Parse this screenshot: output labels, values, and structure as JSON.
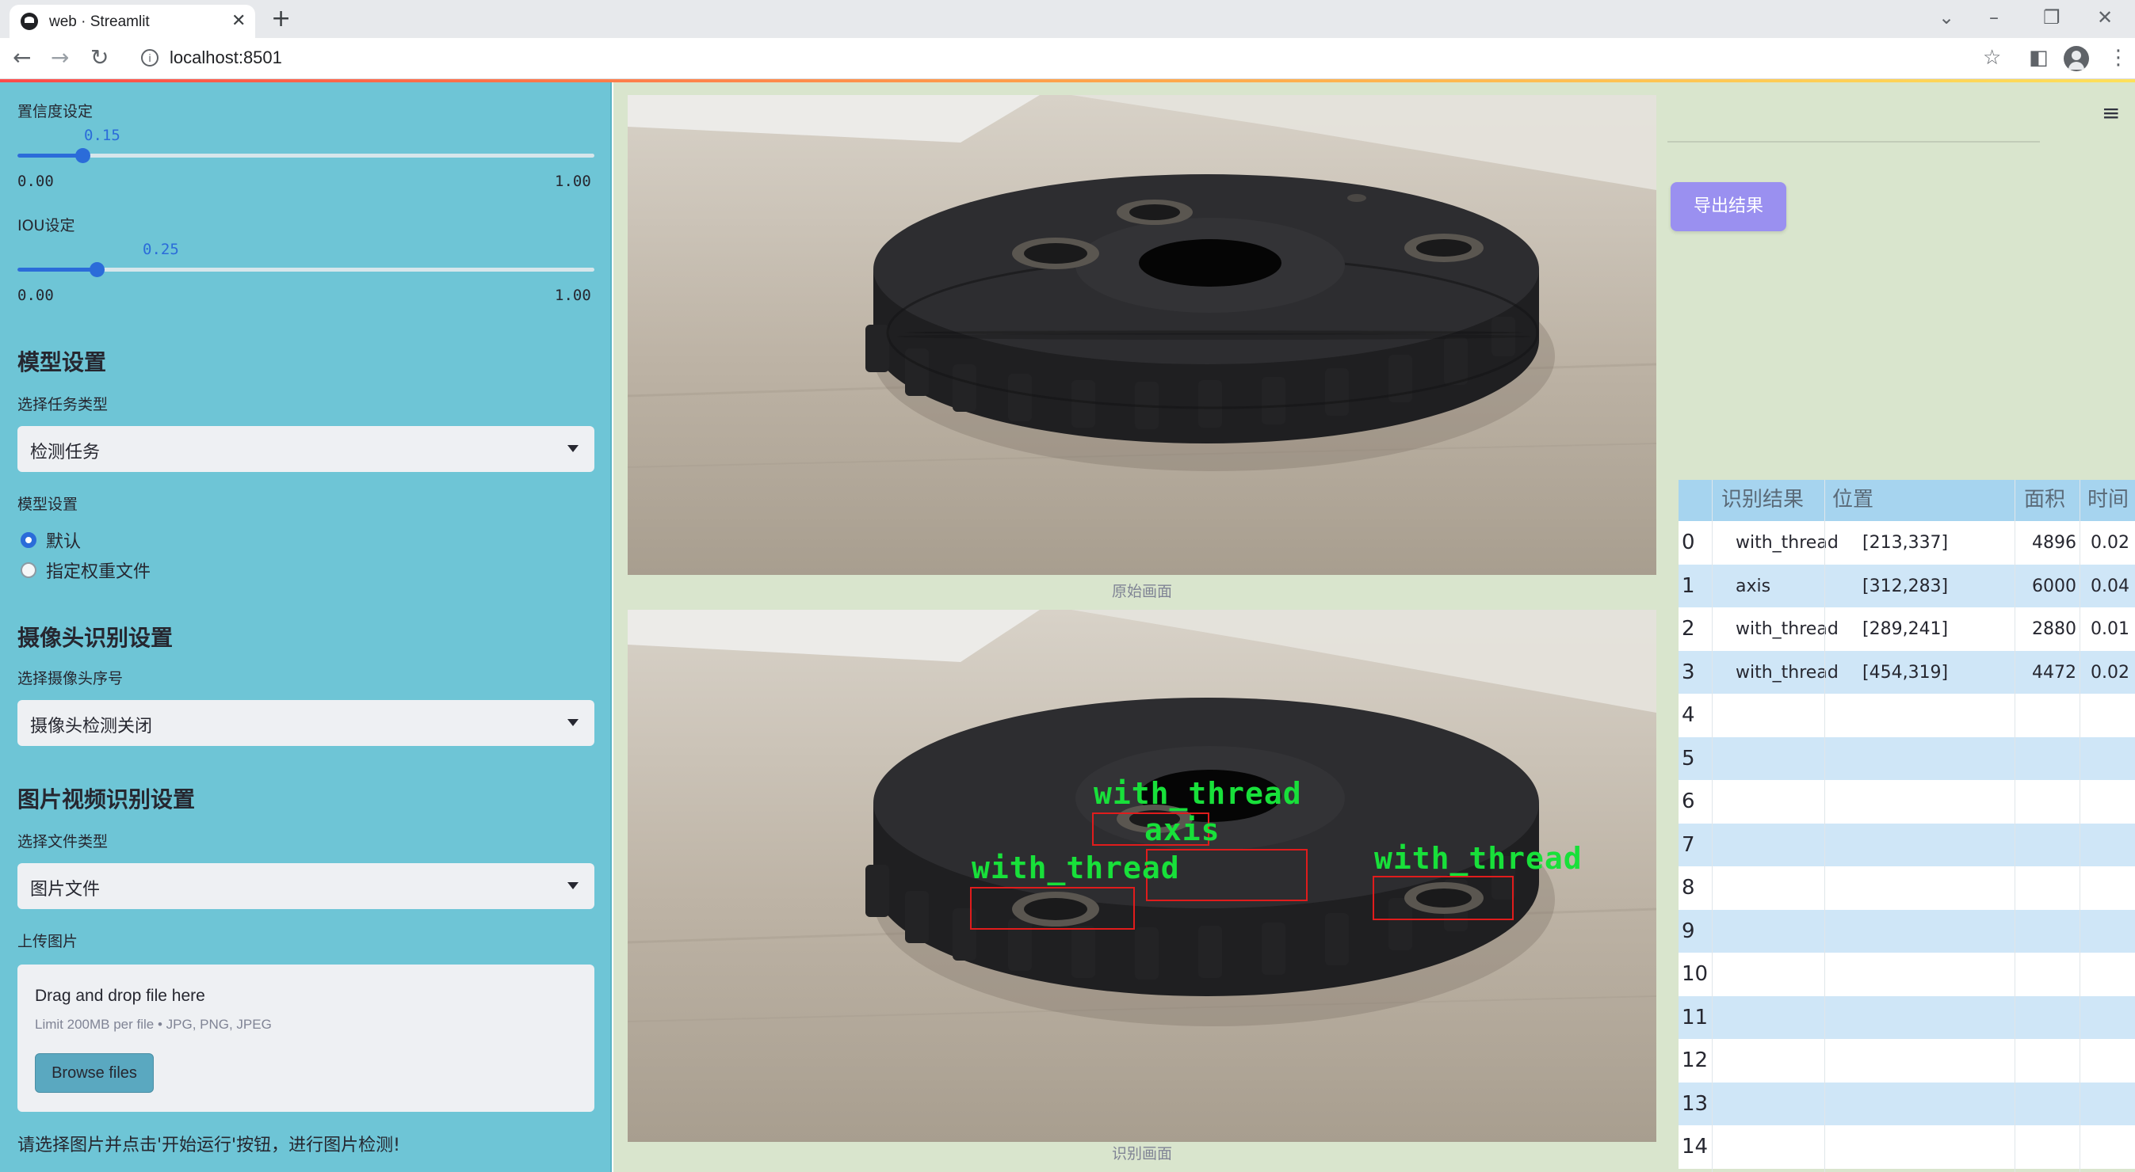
{
  "browser": {
    "tab_title": "web · Streamlit",
    "url": "localhost:8501"
  },
  "sidebar": {
    "confidence": {
      "label": "置信度设定",
      "value": "0.15",
      "min": "0.00",
      "max": "1.00",
      "fraction": 0.15
    },
    "iou": {
      "label": "IOU设定",
      "value": "0.25",
      "min": "0.00",
      "max": "1.00",
      "fraction": 0.25
    },
    "model_section": {
      "title": "模型设置",
      "task_label": "选择任务类型",
      "task_value": "检测任务",
      "weights_label": "模型设置",
      "options": [
        "默认",
        "指定权重文件"
      ],
      "selected": 0
    },
    "camera_section": {
      "title": "摄像头识别设置",
      "camera_label": "选择摄像头序号",
      "camera_value": "摄像头检测关闭"
    },
    "media_section": {
      "title": "图片视频识别设置",
      "file_type_label": "选择文件类型",
      "file_type_value": "图片文件",
      "upload_label": "上传图片",
      "dropzone_title": "Drag and drop file here",
      "dropzone_limit": "Limit 200MB per file • JPG, PNG, JPEG",
      "browse_label": "Browse files"
    },
    "hint": "请选择图片并点击'开始运行'按钮，进行图片检测!"
  },
  "main": {
    "original_caption": "原始画面",
    "result_caption": "识别画面",
    "detections": [
      {
        "label": "with_thread"
      },
      {
        "label": "axis"
      },
      {
        "label": "with_thread"
      },
      {
        "label": "with_thread"
      }
    ],
    "export_label": "导出结果"
  },
  "table": {
    "headers": [
      "识别结果",
      "位置",
      "面积",
      "时间"
    ],
    "rows": [
      {
        "idx": "0",
        "result": "with_thread",
        "pos": "[213,337]",
        "area": "4896",
        "time": "0.02"
      },
      {
        "idx": "1",
        "result": "axis",
        "pos": "[312,283]",
        "area": "6000",
        "time": "0.04"
      },
      {
        "idx": "2",
        "result": "with_thread",
        "pos": "[289,241]",
        "area": "2880",
        "time": "0.01"
      },
      {
        "idx": "3",
        "result": "with_thread",
        "pos": "[454,319]",
        "area": "4472",
        "time": "0.02"
      },
      {
        "idx": "4"
      },
      {
        "idx": "5"
      },
      {
        "idx": "6"
      },
      {
        "idx": "7"
      },
      {
        "idx": "8"
      },
      {
        "idx": "9"
      },
      {
        "idx": "10"
      },
      {
        "idx": "11"
      },
      {
        "idx": "12"
      },
      {
        "idx": "13"
      },
      {
        "idx": "14"
      }
    ]
  },
  "colors": {
    "sidebar_bg": "#6ec5d6",
    "main_bg": "#d9e5cd",
    "accent": "#2b6cd9",
    "export_button": "#9a90f0",
    "box": "#e01c1c",
    "box_label": "#18e03a"
  },
  "icons": [
    "back-icon",
    "forward-icon",
    "reload-icon",
    "info-icon",
    "star-icon",
    "side-panel-icon",
    "profile-icon",
    "menu-icon",
    "hamburger-icon",
    "chevron-down-icon"
  ]
}
